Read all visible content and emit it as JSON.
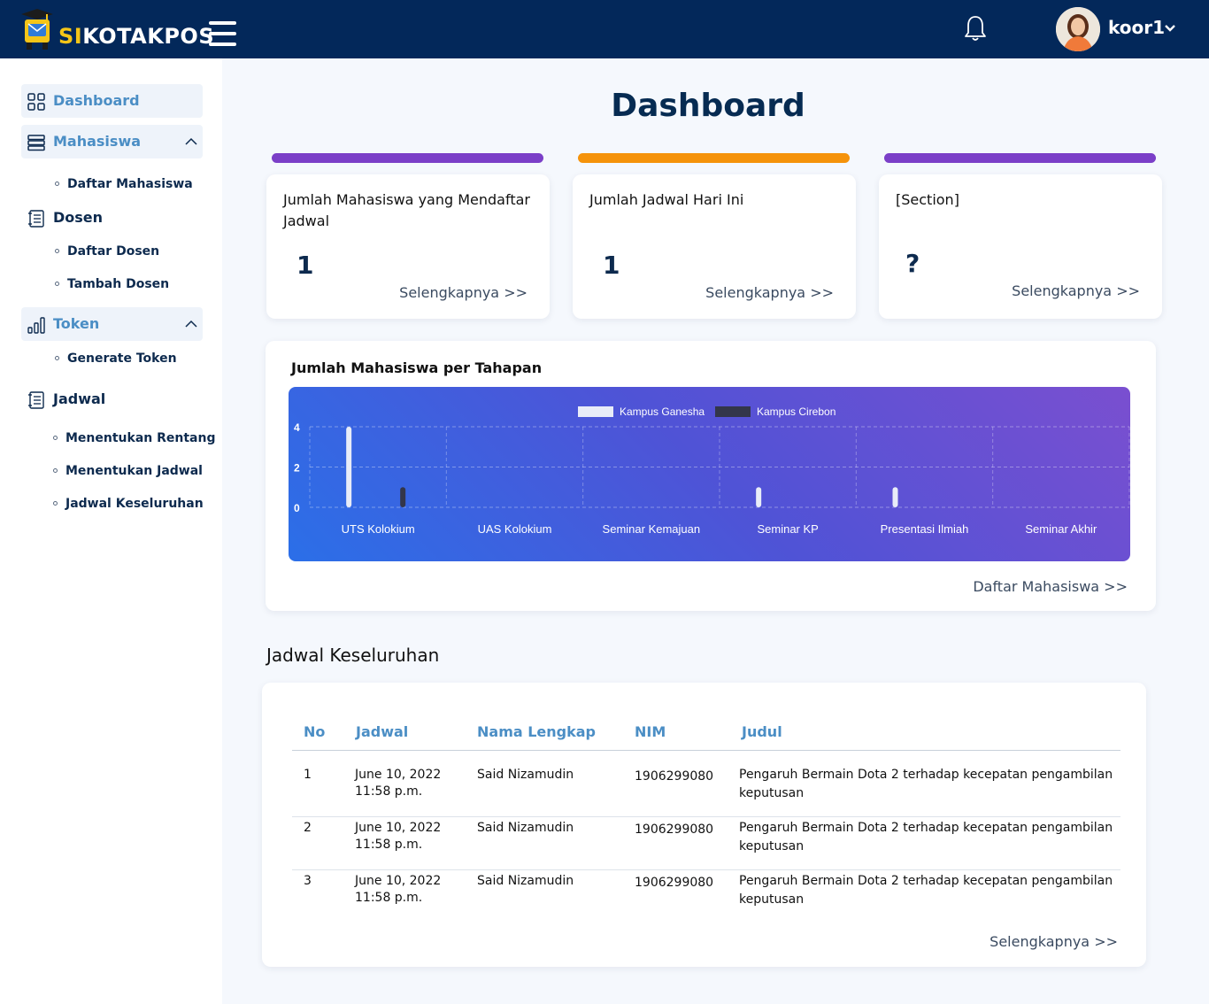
{
  "app": {
    "brand_prefix": "SI",
    "brand_suffix": "KOTAKPOS",
    "username": "koor1"
  },
  "sidebar": {
    "items": [
      {
        "label": "Dashboard",
        "icon": "grid-icon"
      },
      {
        "label": "Mahasiswa",
        "icon": "server-icon",
        "sub": [
          "Daftar Mahasiswa"
        ]
      },
      {
        "label": "Dosen",
        "icon": "document-list-icon",
        "sub": [
          "Daftar Dosen",
          "Tambah Dosen"
        ]
      },
      {
        "label": "Token",
        "icon": "bar-chart-icon",
        "sub": [
          "Generate Token"
        ]
      },
      {
        "label": "Jadwal",
        "icon": "document-list-icon",
        "sub": [
          "Menentukan Rentang",
          "Menentukan Jadwal",
          "Jadwal Keseluruhan"
        ]
      }
    ]
  },
  "main": {
    "title": "Dashboard",
    "cards": [
      {
        "title": "Jumlah Mahasiswa yang Mendaftar Jadwal",
        "value": "1",
        "link": "Selengkapnya >>",
        "bar_color": "#7b3fc8"
      },
      {
        "title": "Jumlah Jadwal Hari Ini",
        "value": "1",
        "link": "Selengkapnya >>",
        "bar_color": "#f5930b"
      },
      {
        "title": "[Section]",
        "value": "?",
        "link": "Selengkapnya >>",
        "bar_color": "#7b3fc8"
      }
    ],
    "chart_section": {
      "title": "Jumlah Mahasiswa per Tahapan",
      "link": "Daftar Mahasiswa >>"
    },
    "schedule": {
      "title": "Jadwal Keseluruhan",
      "headers": [
        "No",
        "Jadwal",
        "Nama Lengkap",
        "NIM",
        "Judul"
      ],
      "rows": [
        {
          "no": "1",
          "date": "June 10, 2022",
          "time": "11:58 p.m.",
          "name": "Said Nizamudin",
          "nim": "1906299080",
          "judul_1": "Pengaruh Bermain Dota 2 terhadap kecepatan pengambilan",
          "judul_2": "keputusan"
        },
        {
          "no": "2",
          "date": "June 10, 2022",
          "time": "11:58 p.m.",
          "name": "Said Nizamudin",
          "nim": "1906299080",
          "judul_1": "Pengaruh Bermain Dota 2 terhadap kecepatan pengambilan",
          "judul_2": "keputusan"
        },
        {
          "no": "3",
          "date": "June 10, 2022",
          "time": "11:58 p.m.",
          "name": "Said Nizamudin",
          "nim": "1906299080",
          "judul_1": "Pengaruh Bermain Dota 2 terhadap kecepatan pengambilan",
          "judul_2": "keputusan"
        }
      ],
      "link": "Selengkapnya >>"
    }
  },
  "chart_data": {
    "type": "bar",
    "categories": [
      "UTS Kolokium",
      "UAS Kolokium",
      "Seminar Kemajuan",
      "Seminar KP",
      "Presentasi Ilmiah",
      "Seminar Akhir"
    ],
    "series": [
      {
        "name": "Kampus Ganesha",
        "values": [
          4,
          0,
          0,
          1,
          1,
          0
        ],
        "color": "#e8ecf8"
      },
      {
        "name": "Kampus Cirebon",
        "values": [
          1,
          0,
          0,
          0,
          0,
          0
        ],
        "color": "#33364a"
      }
    ],
    "yticks": [
      "0",
      "2",
      "4"
    ],
    "ylim": [
      0,
      4
    ],
    "grid": true,
    "legend": "top-center"
  }
}
